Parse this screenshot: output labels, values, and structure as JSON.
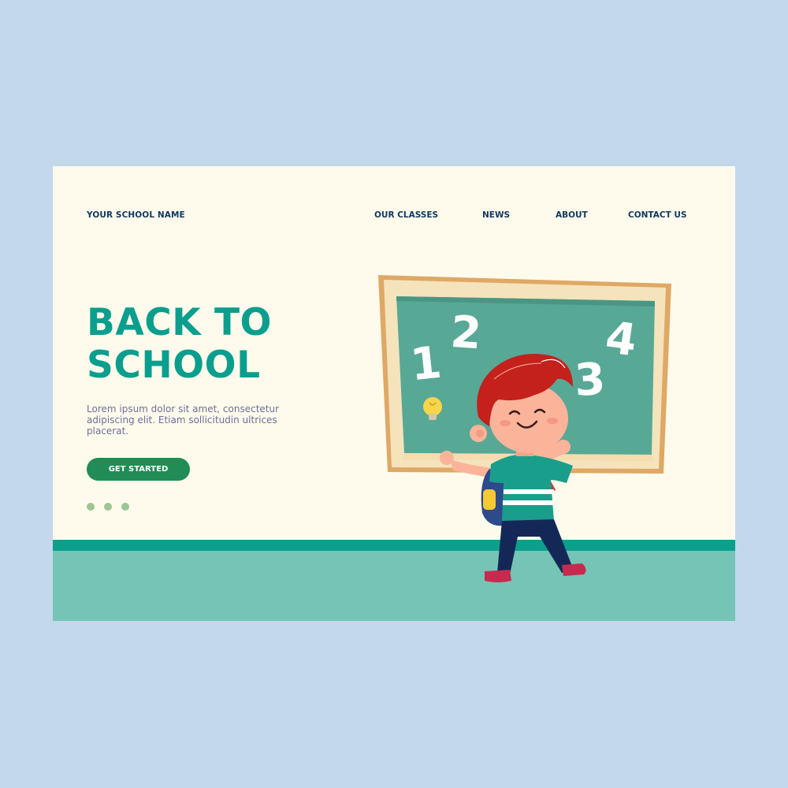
{
  "header": {
    "brand": "YOUR SCHOOL NAME",
    "nav": [
      {
        "label": "OUR CLASSES"
      },
      {
        "label": "NEWS"
      },
      {
        "label": "ABOUT"
      },
      {
        "label": "CONTACT US"
      }
    ]
  },
  "hero": {
    "title_line1": "BACK TO",
    "title_line2": "SCHOOL",
    "text": "Lorem ipsum dolor sit amet, consectetur adipiscing elit. Etiam sollicitudin ultrices placerat.",
    "cta_label": "GET STARTED",
    "slide_count": 3
  },
  "illustration": {
    "chalkboard_numbers": [
      "1",
      "2",
      "3",
      "4"
    ],
    "icons": [
      "chalkboard-icon",
      "lightbulb-icon",
      "student-boy-icon",
      "backpack-icon"
    ]
  },
  "colors": {
    "background": "#c3d8eb",
    "page": "#fffbec",
    "accent": "#0a9e8e",
    "nav_text": "#10385f",
    "button": "#218c55",
    "body_text": "#6f6d9c",
    "dots": "#9ec597",
    "floor": "#75c4b6",
    "floor_stripe": "#0aa08c",
    "chalkboard": "#58a896"
  }
}
